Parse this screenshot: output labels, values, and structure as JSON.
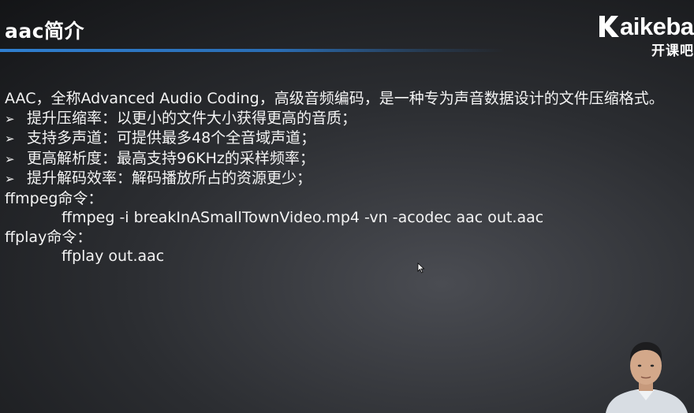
{
  "slide": {
    "title": "aac简介"
  },
  "logo": {
    "brand": "aikeba",
    "subtitle": "开课吧"
  },
  "content": {
    "intro": "AAC，全称Advanced Audio Coding，高级音频编码，是一种专为声音数据设计的文件压缩格式。",
    "bullets": [
      "提升压缩率：以更小的文件大小获得更高的音质；",
      "支持多声道：可提供最多48个全音域声道；",
      "更高解析度：最高支持96KHz的采样频率；",
      "提升解码效率：解码播放所占的资源更少；"
    ],
    "bullet_marker": "➢",
    "ffmpeg_label": "ffmpeg命令：",
    "ffmpeg_command": "ffmpeg -i breakInASmallTownVideo.mp4 -vn -acodec aac out.aac",
    "ffplay_label": "ffplay命令：",
    "ffplay_command": "ffplay out.aac"
  },
  "colors": {
    "accent_rule": "#2f7fd0",
    "text": "#f4f4f4",
    "background": "#2b2d31"
  },
  "icons": {
    "logo_mark": "kaikeba-k-logo-icon",
    "cursor": "mouse-cursor-icon",
    "presenter": "presenter-video-thumbnail"
  }
}
